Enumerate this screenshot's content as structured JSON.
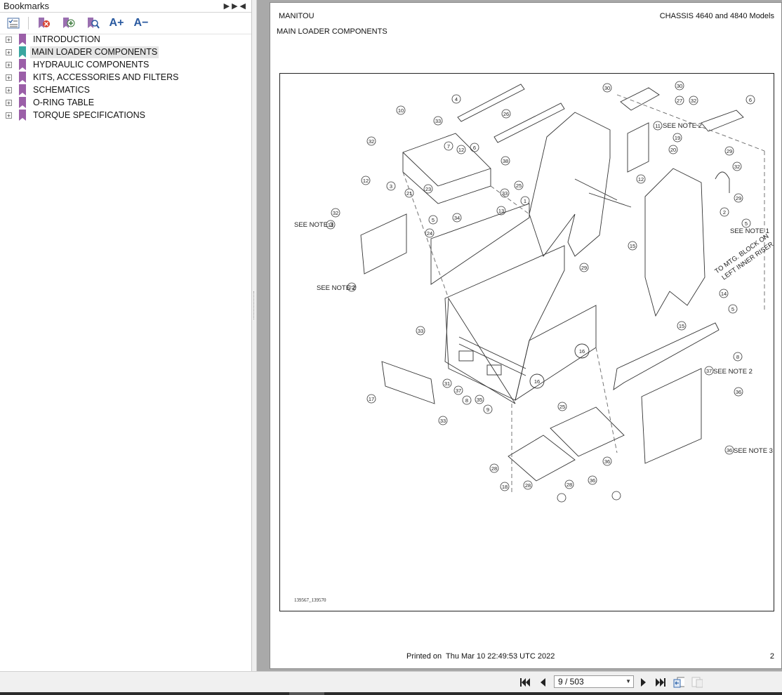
{
  "sidebar": {
    "title": "Bookmarks",
    "toolbar": {
      "options_icon": "bookmark-options-icon",
      "delete_icon": "delete-bookmark-icon",
      "add_icon": "add-bookmark-icon",
      "find_icon": "find-bookmark-icon",
      "increase_font_label": "A+",
      "decrease_font_label": "A−"
    },
    "items": [
      {
        "label": "INTRODUCTION",
        "selected": false
      },
      {
        "label": "MAIN LOADER COMPONENTS",
        "selected": true
      },
      {
        "label": "HYDRAULIC COMPONENTS",
        "selected": false
      },
      {
        "label": "KITS, ACCESSORIES AND FILTERS",
        "selected": false
      },
      {
        "label": "SCHEMATICS",
        "selected": false
      },
      {
        "label": "O-RING TABLE",
        "selected": false
      },
      {
        "label": "TORQUE SPECIFICATIONS",
        "selected": false
      }
    ]
  },
  "page": {
    "header_left": "MANITOU",
    "header_right": "CHASSIS 4640 and 4840 Models",
    "section_title": "MAIN LOADER COMPONENTS",
    "drawing_id": "139567_139570",
    "printed_label": "Printed on",
    "printed_date": "Thu Mar 10 22:49:53 UTC 2022",
    "page_number": "2",
    "notes": {
      "note1": "SEE NOTE 1",
      "note2a": "SEE NOTE 2",
      "note2b": "SEE NOTE 2",
      "note2c": "SEE NOTE 2",
      "note3a": "SEE NOTE 3",
      "note3b": "SEE NOTE 3",
      "mtg_line1": "TO MTG. BLOCK ON",
      "mtg_line2": "LEFT INNER RISER"
    },
    "callouts": [
      "16",
      "16",
      "4",
      "26",
      "30",
      "30",
      "27",
      "32",
      "6",
      "10",
      "33",
      "11",
      "19",
      "20",
      "32",
      "12",
      "6",
      "7",
      "38",
      "29",
      "32",
      "12",
      "3",
      "21",
      "12",
      "23",
      "33",
      "25",
      "29",
      "32",
      "12",
      "5",
      "34",
      "13",
      "1",
      "2",
      "5",
      "24",
      "15",
      "29",
      "22",
      "14",
      "5",
      "33",
      "15",
      "8",
      "37",
      "31",
      "37",
      "8",
      "35",
      "9",
      "17",
      "33",
      "25",
      "36",
      "36",
      "28",
      "36",
      "18",
      "28",
      "28",
      "36"
    ]
  },
  "navigation": {
    "page_field": "9 / 503",
    "first_icon": "first-page-icon",
    "prev_icon": "previous-page-icon",
    "next_icon": "next-page-icon",
    "last_icon": "last-page-icon",
    "prev_view_icon": "previous-view-icon",
    "next_view_icon": "next-view-icon"
  }
}
